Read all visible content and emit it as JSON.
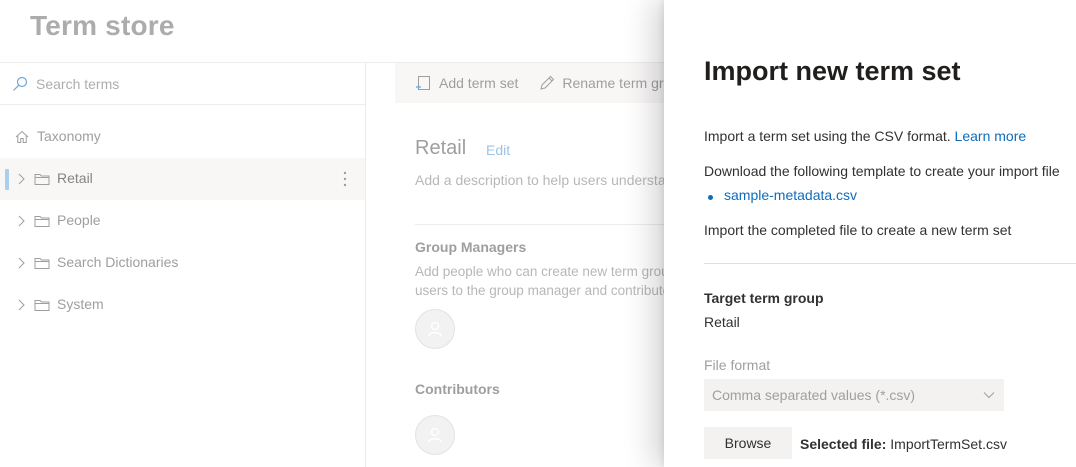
{
  "header": {
    "title": "Term store"
  },
  "left_nav": {
    "search_placeholder": "Search terms",
    "root": {
      "label": "Taxonomy",
      "icon": "home-icon"
    },
    "groups": [
      {
        "label": "Retail",
        "selected": true
      },
      {
        "label": "People",
        "selected": false
      },
      {
        "label": "Search Dictionaries",
        "selected": false
      },
      {
        "label": "System",
        "selected": false
      }
    ]
  },
  "toolbar": {
    "add_term_set_label": "Add term set",
    "rename_term_group_label": "Rename term group"
  },
  "main": {
    "group_name": "Retail",
    "edit_label": "Edit",
    "description_placeholder": "Add a description to help users understand",
    "group_managers_title": "Group Managers",
    "group_managers_desc_line1": "Add people who can create new term groups",
    "group_managers_desc_line2": "users to the group manager and contributor",
    "contributors_title": "Contributors"
  },
  "import_panel": {
    "title": "Import new term set",
    "intro_text": "Import a term set using the CSV format.",
    "learn_more_label": "Learn more",
    "download_text": "Download the following template to create your import file",
    "template_file": "sample-metadata.csv",
    "completed_text": "Import the completed file to create a new term set",
    "target_group_label": "Target term group",
    "target_group_value": "Retail",
    "file_format_label": "File format",
    "file_format_value": "Comma separated values (*.csv)",
    "browse_label": "Browse",
    "selected_file_label": "Selected file:",
    "selected_file_value": "ImportTermSet.csv"
  },
  "colors": {
    "accent_link": "#0f6cbd",
    "selection_bar": "#71afe5",
    "header_title": "#757575"
  }
}
